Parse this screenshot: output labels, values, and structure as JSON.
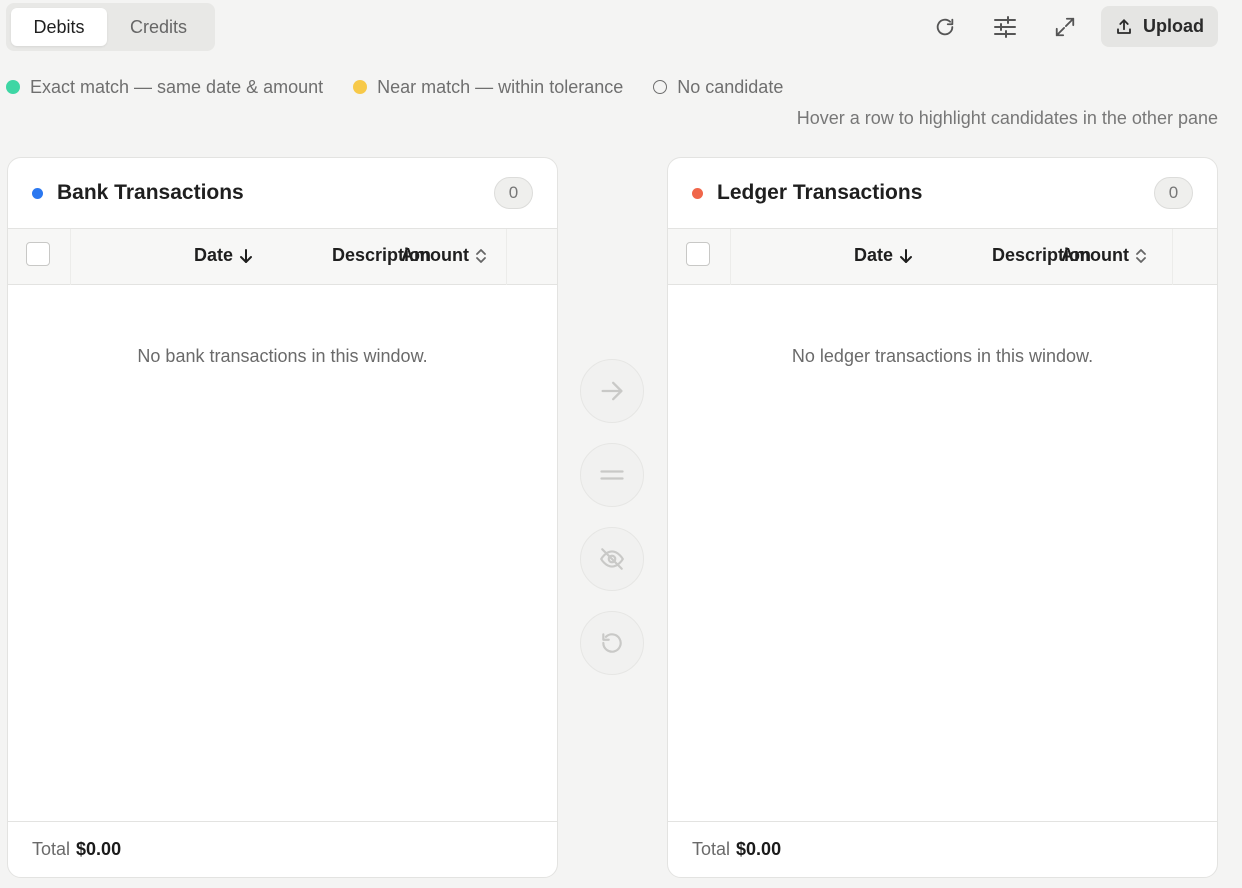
{
  "tabs": [
    {
      "label": "Debits",
      "active": true
    },
    {
      "label": "Credits",
      "active": false
    }
  ],
  "toolbar": {
    "refresh_icon": "refresh-icon",
    "filters_icon": "sliders-icon",
    "expand_icon": "expand-icon",
    "upload_label": "Upload"
  },
  "legend": {
    "exact": {
      "label": "Exact match — same date & amount",
      "color": "#3ed6a4"
    },
    "near": {
      "label": "Near match — within tolerance",
      "color": "#f7c949"
    },
    "none": {
      "label": "No candidate"
    }
  },
  "hint": "Hover a row to highlight candidates in the other pane",
  "bank": {
    "title": "Bank Transactions",
    "dot_color": "#2b78f0",
    "count": "0",
    "columns": {
      "date": "Date",
      "description": "Description",
      "amount": "Amount"
    },
    "empty": "No bank transactions in this window.",
    "total_label": "Total",
    "total_value": "$0.00"
  },
  "ledger": {
    "title": "Ledger Transactions",
    "dot_color": "#f0664a",
    "count": "0",
    "columns": {
      "date": "Date",
      "description": "Description",
      "amount": "Amount"
    },
    "empty": "No ledger transactions in this window.",
    "total_label": "Total",
    "total_value": "$0.00"
  },
  "actions": [
    "arrow-right-icon",
    "equals-icon",
    "eye-off-icon",
    "undo-icon"
  ]
}
